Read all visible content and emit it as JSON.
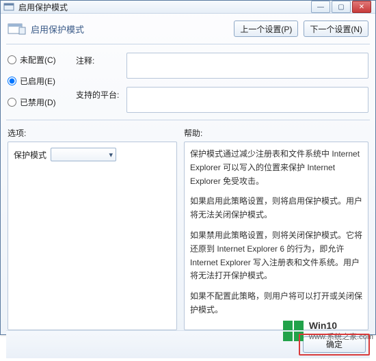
{
  "window": {
    "title": "启用保护模式",
    "controls": {
      "min": "—",
      "max": "▢",
      "close": "✕"
    }
  },
  "header": {
    "section_title": "启用保护模式",
    "prev_button": "上一个设置(P)",
    "next_button": "下一个设置(N)"
  },
  "config": {
    "radios": {
      "unconfigured": "未配置(C)",
      "enabled": "已启用(E)",
      "disabled": "已禁用(D)"
    },
    "comment_label": "注释:",
    "platform_label": "支持的平台:",
    "comment_value": "",
    "platform_value": ""
  },
  "labels": {
    "options": "选项:",
    "help": "帮助:"
  },
  "options_panel": {
    "protection_mode_label": "保护模式",
    "combo_selected": ""
  },
  "help_panel": {
    "p1": "保护模式通过减少注册表和文件系统中 Internet Explorer 可以写入的位置来保护 Internet Explorer 免受攻击。",
    "p2": "如果启用此策略设置，则将启用保护模式。用户将无法关闭保护模式。",
    "p3": "如果禁用此策略设置，则将关闭保护模式。它将还原到 Internet Explorer 6 的行为，即允许 Internet Explorer 写入注册表和文件系统。用户将无法打开保护模式。",
    "p4": "如果不配置此策略，则用户将可以打开或关闭保护模式。"
  },
  "footer": {
    "ok": "确定"
  },
  "watermark": {
    "brand": "Win10",
    "site": "www.系统之家.com"
  }
}
